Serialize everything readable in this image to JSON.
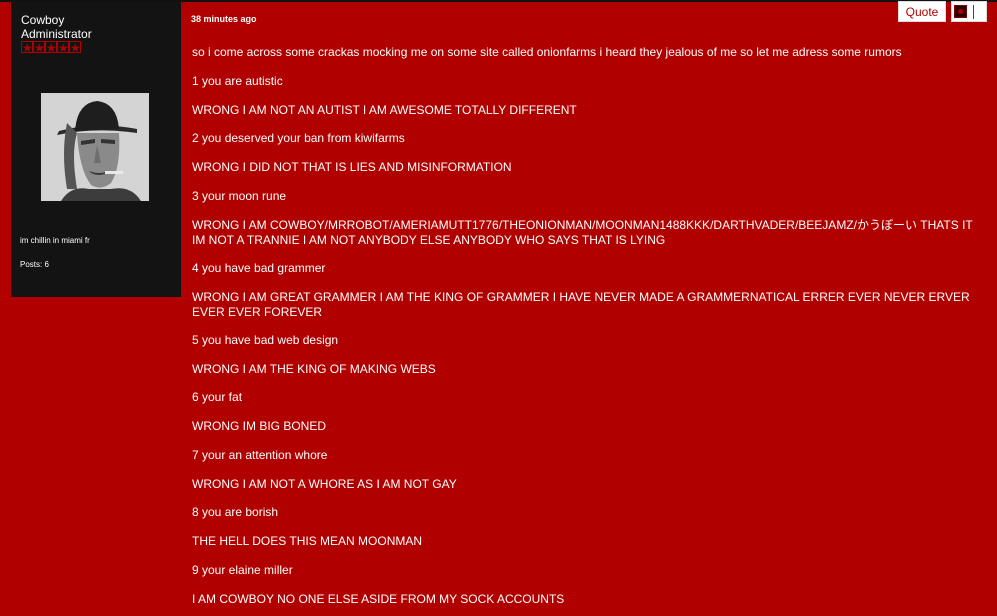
{
  "author": {
    "name": "Cowboy",
    "role": "Administrator",
    "rank_stars": 5,
    "signature": "im chillin in miami fr",
    "posts": "Posts: 6",
    "avatar_icon": "avatar-photo"
  },
  "post": {
    "time": "38 minutes ago",
    "quote_label": "Quote",
    "paragraphs": [
      "so i come across some crackas mocking me on some site called onionfarms i heard they jealous of me so let me adress some rumors",
      "1 you are autistic",
      "WRONG I AM NOT AN AUTIST I AM AWESOME TOTALLY DIFFERENT",
      "2 you deserved your ban from kiwifarms",
      "WRONG I DID NOT THAT IS LIES AND MISINFORMATION",
      "3 your moon rune",
      "WRONG I AM COWBOY/MRROBOT/AMERIAMUTT1776/THEONIONMAN/MOONMAN1488KKK/DARTHVADER/BEEJAMZ/かうぼーい THATS IT IM NOT A TRANNIE I AM NOT ANYBODY ELSE ANYBODY WHO SAYS THAT IS LYING",
      "4 you have bad grammer",
      "WRONG I AM GREAT GRAMMER I AM THE KING OF GRAMMER I HAVE NEVER MADE A GRAMMERNATICAL ERRER EVER NEVER ERVER EVER EVER FOREVER",
      "5 you have bad web design",
      "WRONG I AM THE KING OF MAKING WEBS",
      "6 your fat",
      "WRONG IM BIG BONED",
      "7 your an attention whore",
      "WRONG I AM NOT A WHORE AS I AM NOT GAY",
      "8 you are borish",
      "THE HELL DOES THIS MEAN MOONMAN",
      "9 your elaine miller",
      "I AM COWBOY NO ONE ELSE ASIDE FROM MY SOCK ACCOUNTS"
    ]
  },
  "colors": {
    "background": "#b00000",
    "sidebar": "#131313",
    "text": "#ffffff"
  }
}
